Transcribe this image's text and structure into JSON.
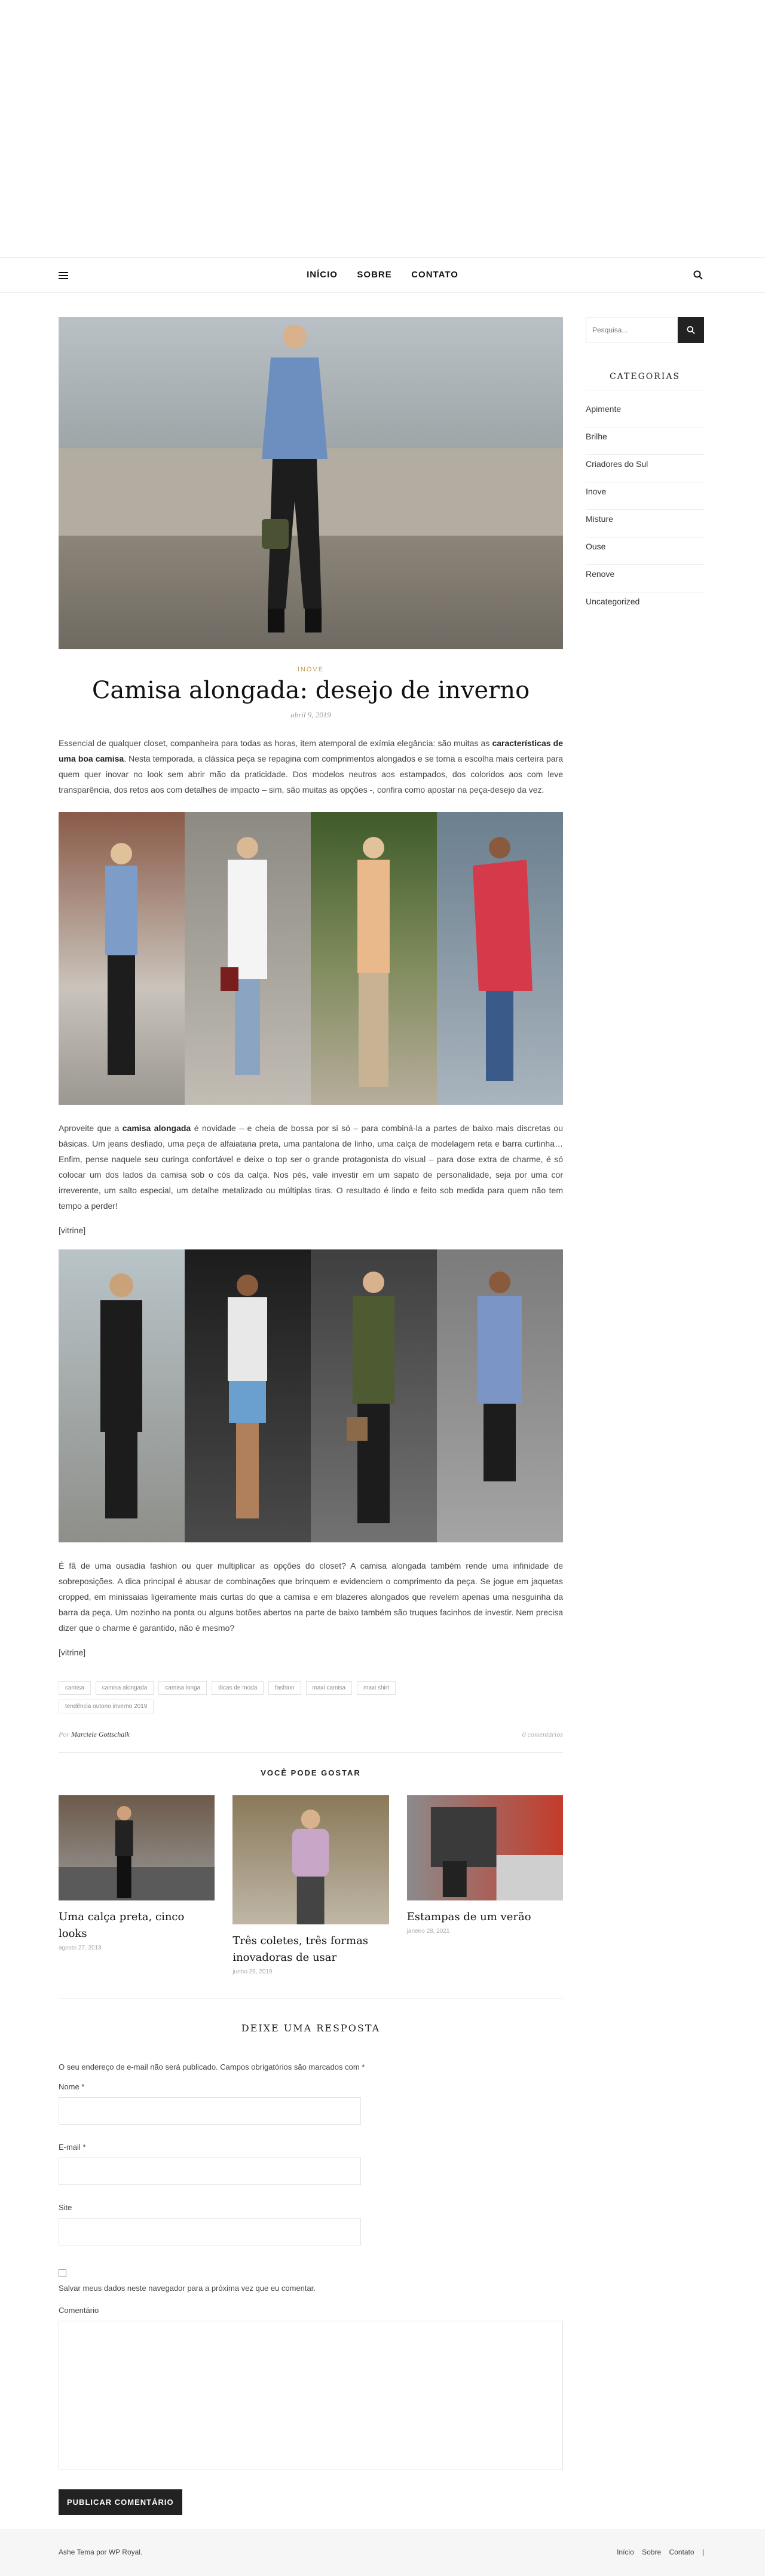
{
  "nav": {
    "items": [
      "INÍCIO",
      "SOBRE",
      "CONTATO"
    ]
  },
  "post": {
    "category": "INOVE",
    "title": "Camisa alongada: desejo de inverno",
    "date": "abril 9, 2019",
    "intro_start": "Essencial de qualquer closet, companheira para todas as horas, item atemporal de exímia elegância: são muitas as ",
    "intro_bold": "características de uma boa camisa",
    "intro_end": ". Nesta temporada, a clássica peça se repagina com comprimentos alongados e se torna a escolha mais certeira para quem quer inovar no look sem abrir mão da praticidade. Dos modelos neutros aos estampados, dos coloridos aos com leve transparência, dos retos aos com detalhes de impacto – sim, são muitas as opções -, confira como apostar na peça-desejo da vez.",
    "p2_start": "Aproveite que a ",
    "p2_bold": "camisa alongada",
    "p2_end": " é novidade – e cheia de bossa por si só – para combiná-la a partes de baixo mais discretas ou básicas. Um jeans desfiado, uma peça de alfaiataria preta, uma pantalona de linho, uma calça de modelagem reta e barra curtinha… Enfim, pense naquele seu curinga confortável e deixe o top ser o grande protagonista do visual – para dose extra de charme, é só colocar um dos lados da camisa sob o cós da calça. Nos pés, vale investir em um sapato de personalidade, seja por uma cor irreverente, um salto especial, um detalhe metalizado ou múltiplas tiras. O resultado é lindo e feito sob medida para quem não tem tempo a perder!",
    "vitrine1": "[vitrine]",
    "p3": "É fã de uma ousadia fashion ou quer multiplicar as opções do closet? A camisa alongada também rende uma infinidade de sobreposições. A dica principal é abusar de combinações que brinquem e evidenciem o comprimento da peça. Se jogue em jaquetas cropped, em minissaias ligeiramente mais curtas do que a camisa e em blazeres alongados que revelem apenas uma nesguinha da barra da peça. Um nozinho na ponta ou alguns botões abertos na parte de baixo também são truques facinhos de investir. Nem precisa dizer que o charme é garantido, não é mesmo?",
    "vitrine2": "[vitrine]",
    "tags": [
      "camisa",
      "camisa alongada",
      "camisa longa",
      "dicas de moda",
      "fashion",
      "maxi camisa",
      "maxi shirt",
      "tendência outono inverno 2019"
    ],
    "author_prefix": "Por",
    "author": "Marciele Gottschalk",
    "comments": "0 comentários"
  },
  "related": {
    "title": "VOCÊ PODE GOSTAR",
    "items": [
      {
        "title": "Uma calça preta, cinco looks",
        "date": "agosto 27, 2018"
      },
      {
        "title": "Três coletes, três formas inovadoras de usar",
        "date": "junho 26, 2019"
      },
      {
        "title": "Estampas de um verão",
        "date": "janeiro 28, 2021"
      }
    ]
  },
  "comment_form": {
    "title": "DEIXE UMA RESPOSTA",
    "note": "O seu endereço de e-mail não será publicado. Campos obrigatórios são marcados com *",
    "name_label": "Nome *",
    "email_label": "E-mail *",
    "site_label": "Site",
    "save_label": "Salvar meus dados neste navegador para a próxima vez que eu comentar.",
    "comment_label": "Comentário",
    "submit_label": "PUBLICAR COMENTÁRIO"
  },
  "sidebar": {
    "search_placeholder": "Pesquisa...",
    "categories_title": "CATEGORIAS",
    "categories": [
      "Apimente",
      "Brilhe",
      "Criadores do Sul",
      "Inove",
      "Misture",
      "Ouse",
      "Renove",
      "Uncategorized"
    ]
  },
  "footer": {
    "credit": "Ashe Tema por WP Royal.",
    "links": [
      "Início",
      "Sobre",
      "Contato",
      "|"
    ]
  },
  "colors": {
    "accent": "#ca9b52",
    "dark": "#222222"
  }
}
